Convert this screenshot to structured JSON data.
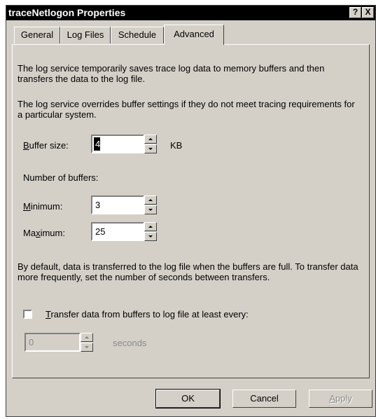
{
  "window": {
    "title": "traceNetlogon Properties",
    "help_glyph": "?",
    "close_glyph": "X"
  },
  "tabs": [
    {
      "label": "General",
      "active": false
    },
    {
      "label": "Log Files",
      "active": false
    },
    {
      "label": "Schedule",
      "active": false
    },
    {
      "label": "Advanced",
      "active": true
    }
  ],
  "advanced": {
    "para1": "The log service temporarily saves trace log data to memory buffers and then transfers the data to the log file.",
    "para2": "The log service overrides buffer settings if they do not meet tracing requirements for a particular system.",
    "buffer_size": {
      "label_ak": "B",
      "label_rest": "uffer size:",
      "value": "4",
      "unit": "KB"
    },
    "number_of_buffers_label": "Number of buffers:",
    "minimum": {
      "label_ak": "M",
      "label_rest": "inimum:",
      "value": "3"
    },
    "maximum": {
      "label_pre": "Ma",
      "label_ak": "x",
      "label_rest": "imum:",
      "value": "25"
    },
    "para3": "By default, data is transferred to the log file when the buffers are full. To transfer data more frequently, set the number of seconds between transfers.",
    "transfer_checkbox": {
      "label_ak": "T",
      "label_rest": "ransfer data from buffers to log file at least every:",
      "checked": false
    },
    "seconds": {
      "value": "0",
      "unit": "seconds",
      "disabled": true
    }
  },
  "buttons": {
    "ok": "OK",
    "cancel": "Cancel",
    "apply_ak": "A",
    "apply_rest": "pply"
  }
}
